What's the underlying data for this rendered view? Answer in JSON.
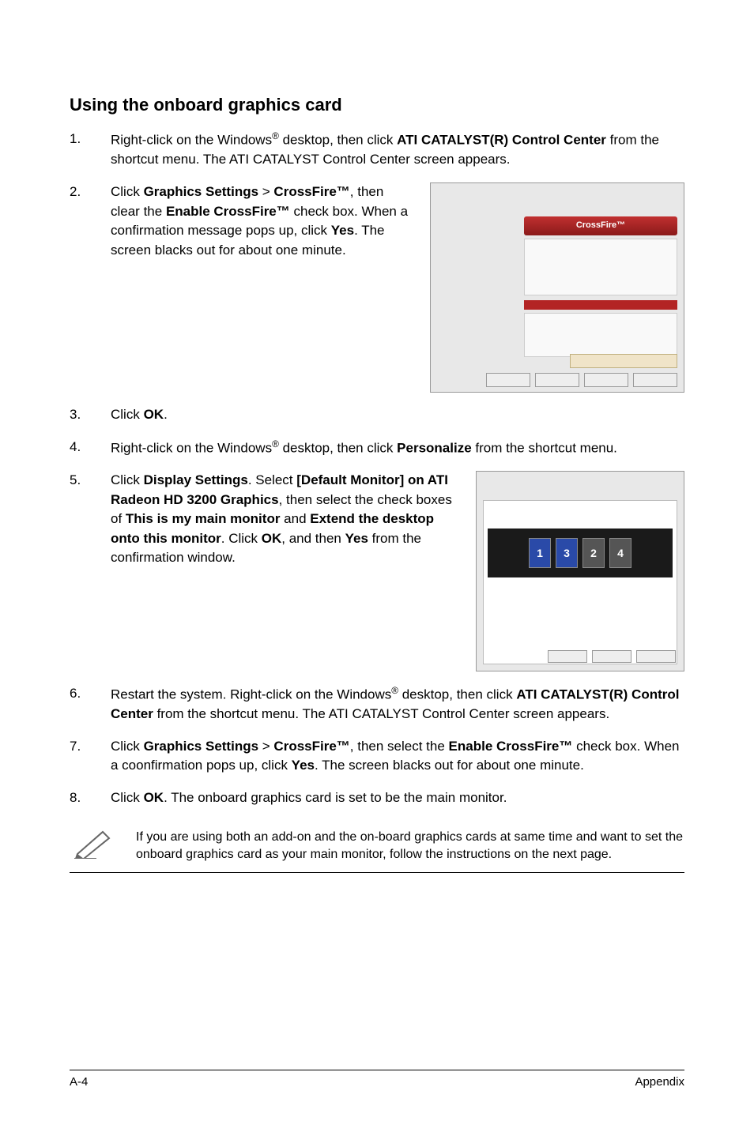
{
  "heading": "Using the onboard graphics card",
  "steps": {
    "s1_a": "Right-click on the Windows",
    "s1_b": " desktop, then click ",
    "s1_bold": "ATI CATALYST(R) Control Center",
    "s1_c": " from the shortcut menu. The ATI CATALYST Control Center screen appears.",
    "s2_a": "Click ",
    "s2_b1": "Graphics Settings",
    "s2_gt": " > ",
    "s2_b2": "CrossFire™",
    "s2_c": ", then clear the ",
    "s2_b3": "Enable CrossFire™",
    "s2_d": " check box. When a confirmation message pops up, click ",
    "s2_b4": "Yes",
    "s2_e": ". The screen blacks out for about one minute.",
    "s3_a": "Click ",
    "s3_b": "OK",
    "s3_c": ".",
    "s4_a": "Right-click on the Windows",
    "s4_b": " desktop, then click ",
    "s4_bold": "Personalize",
    "s4_c": " from the shortcut menu.",
    "s5_a": "Click ",
    "s5_b1": "Display Settings",
    "s5_b": ". Select ",
    "s5_b2": "[Default Monitor] on ATI Radeon HD 3200 Graphics",
    "s5_c": ", then select the check boxes of ",
    "s5_b3": "This is my main monitor",
    "s5_and": " and ",
    "s5_b4": "Extend the desktop onto this monitor",
    "s5_d": ". Click ",
    "s5_b5": "OK",
    "s5_e": ", and then ",
    "s5_b6": "Yes",
    "s5_f": " from the confirmation window.",
    "s6_a": "Restart the system. Right-click on the Windows",
    "s6_b": " desktop, then click ",
    "s6_bold": "ATI CATALYST(R) Control Center",
    "s6_c": " from the shortcut menu. The ATI CATALYST Control Center screen appears.",
    "s7_a": "Click ",
    "s7_b1": "Graphics Settings",
    "s7_gt": " > ",
    "s7_b2": "CrossFire™",
    "s7_c": ", then select the ",
    "s7_b3": "Enable CrossFire™",
    "s7_d": " check box. When a coonfirmation pops up, click ",
    "s7_b4": "Yes",
    "s7_e": ". The screen blacks out for about one minute.",
    "s8_a": "Click ",
    "s8_b": "OK",
    "s8_c": ". The onboard graphics card is set to be the main monitor."
  },
  "reg": "®",
  "thumb1": {
    "crossfire": "CrossFire™"
  },
  "thumb2": {
    "m1": "1",
    "m2": "3",
    "m3": "2",
    "m4": "4"
  },
  "note": "If you are using both an add-on and the on-board graphics cards at same time and want to set the onboard graphics card as your main monitor, follow the instructions on the next page.",
  "footer": {
    "left": "A-4",
    "right": "Appendix"
  }
}
